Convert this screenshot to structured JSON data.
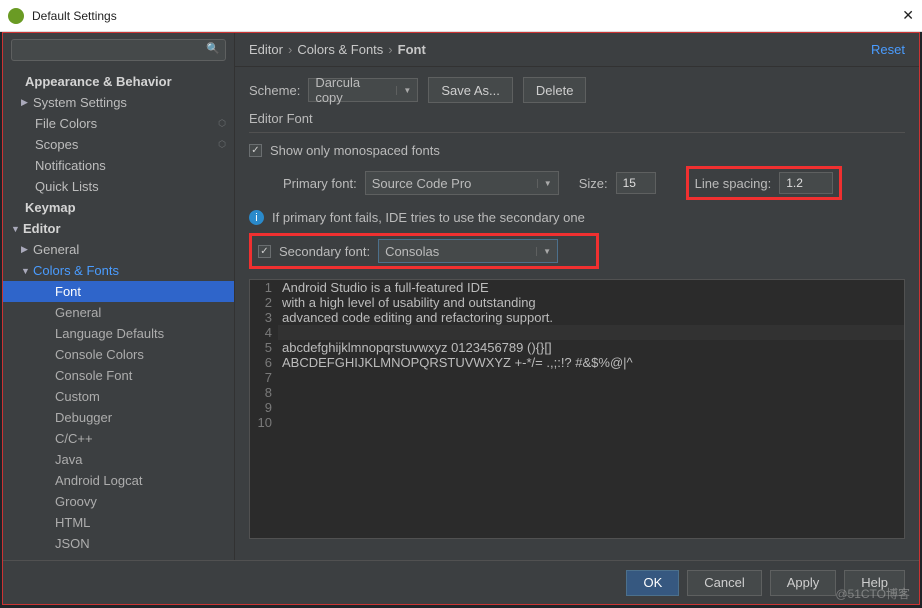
{
  "window": {
    "title": "Default Settings"
  },
  "breadcrumb": {
    "a": "Editor",
    "b": "Colors & Fonts",
    "c": "Font",
    "reset": "Reset"
  },
  "scheme": {
    "label": "Scheme:",
    "value": "Darcula copy",
    "saveas": "Save As...",
    "delete": "Delete"
  },
  "section": "Editor Font",
  "showMono": "Show only monospaced fonts",
  "primary": {
    "label": "Primary font:",
    "value": "Source Code Pro"
  },
  "size": {
    "label": "Size:",
    "value": "15"
  },
  "linespacing": {
    "label": "Line spacing:",
    "value": "1.2"
  },
  "info": "If primary font fails, IDE tries to use the secondary one",
  "secondary": {
    "label": "Secondary font:",
    "value": "Consolas"
  },
  "preview": {
    "l1": "Android Studio is a full-featured IDE",
    "l2": "with a high level of usability and outstanding",
    "l3": "advanced code editing and refactoring support.",
    "l4": "",
    "l5": "abcdefghijklmnopqrstuvwxyz 0123456789 (){}[]",
    "l6": "ABCDEFGHIJKLMNOPQRSTUVWXYZ +-*/= .,;:!? #&$%@|^",
    "l7": "",
    "l8": "",
    "l9": "",
    "l10": ""
  },
  "sidebar": {
    "appearance": "Appearance & Behavior",
    "system": "System Settings",
    "filecolors": "File Colors",
    "scopes": "Scopes",
    "notifications": "Notifications",
    "quicklists": "Quick Lists",
    "keymap": "Keymap",
    "editor": "Editor",
    "general": "General",
    "cf": "Colors & Fonts",
    "font": "Font",
    "general2": "General",
    "langdef": "Language Defaults",
    "consolecolors": "Console Colors",
    "consolefont": "Console Font",
    "custom": "Custom",
    "debugger": "Debugger",
    "cpp": "C/C++",
    "java": "Java",
    "logcat": "Android Logcat",
    "groovy": "Groovy",
    "html": "HTML",
    "json": "JSON"
  },
  "buttons": {
    "ok": "OK",
    "cancel": "Cancel",
    "apply": "Apply",
    "help": "Help"
  },
  "watermark": "@51CTO博客"
}
